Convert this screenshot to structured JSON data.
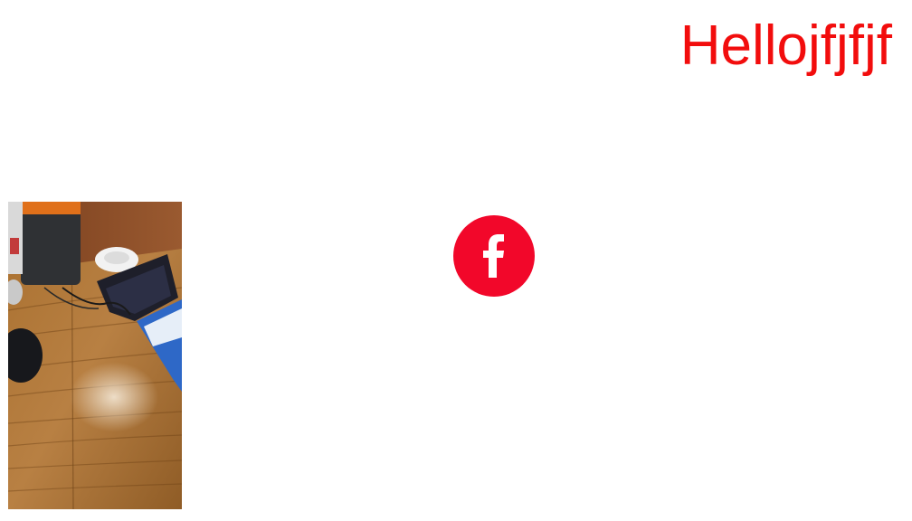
{
  "header": {
    "title": "Hellojfjfjf"
  },
  "photo": {
    "subject": "desk-photo"
  },
  "social": {
    "facebook_icon": "facebook-icon"
  },
  "colors": {
    "title": "#f20d0d",
    "facebook_bg": "#f2072a",
    "facebook_glyph": "#ffffff"
  }
}
